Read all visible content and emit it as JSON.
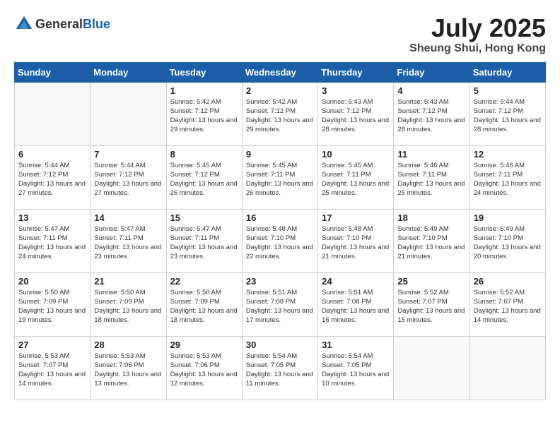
{
  "header": {
    "logo_general": "General",
    "logo_blue": "Blue",
    "month": "July 2025",
    "location": "Sheung Shui, Hong Kong"
  },
  "weekdays": [
    "Sunday",
    "Monday",
    "Tuesday",
    "Wednesday",
    "Thursday",
    "Friday",
    "Saturday"
  ],
  "weeks": [
    [
      {
        "day": "",
        "sunrise": "",
        "sunset": "",
        "daylight": ""
      },
      {
        "day": "",
        "sunrise": "",
        "sunset": "",
        "daylight": ""
      },
      {
        "day": "1",
        "sunrise": "Sunrise: 5:42 AM",
        "sunset": "Sunset: 7:12 PM",
        "daylight": "Daylight: 13 hours and 29 minutes."
      },
      {
        "day": "2",
        "sunrise": "Sunrise: 5:42 AM",
        "sunset": "Sunset: 7:12 PM",
        "daylight": "Daylight: 13 hours and 29 minutes."
      },
      {
        "day": "3",
        "sunrise": "Sunrise: 5:43 AM",
        "sunset": "Sunset: 7:12 PM",
        "daylight": "Daylight: 13 hours and 28 minutes."
      },
      {
        "day": "4",
        "sunrise": "Sunrise: 5:43 AM",
        "sunset": "Sunset: 7:12 PM",
        "daylight": "Daylight: 13 hours and 28 minutes."
      },
      {
        "day": "5",
        "sunrise": "Sunrise: 5:44 AM",
        "sunset": "Sunset: 7:12 PM",
        "daylight": "Daylight: 13 hours and 28 minutes."
      }
    ],
    [
      {
        "day": "6",
        "sunrise": "Sunrise: 5:44 AM",
        "sunset": "Sunset: 7:12 PM",
        "daylight": "Daylight: 13 hours and 27 minutes."
      },
      {
        "day": "7",
        "sunrise": "Sunrise: 5:44 AM",
        "sunset": "Sunset: 7:12 PM",
        "daylight": "Daylight: 13 hours and 27 minutes."
      },
      {
        "day": "8",
        "sunrise": "Sunrise: 5:45 AM",
        "sunset": "Sunset: 7:12 PM",
        "daylight": "Daylight: 13 hours and 26 minutes."
      },
      {
        "day": "9",
        "sunrise": "Sunrise: 5:45 AM",
        "sunset": "Sunset: 7:11 PM",
        "daylight": "Daylight: 13 hours and 26 minutes."
      },
      {
        "day": "10",
        "sunrise": "Sunrise: 5:45 AM",
        "sunset": "Sunset: 7:11 PM",
        "daylight": "Daylight: 13 hours and 25 minutes."
      },
      {
        "day": "11",
        "sunrise": "Sunrise: 5:46 AM",
        "sunset": "Sunset: 7:11 PM",
        "daylight": "Daylight: 13 hours and 25 minutes."
      },
      {
        "day": "12",
        "sunrise": "Sunrise: 5:46 AM",
        "sunset": "Sunset: 7:11 PM",
        "daylight": "Daylight: 13 hours and 24 minutes."
      }
    ],
    [
      {
        "day": "13",
        "sunrise": "Sunrise: 5:47 AM",
        "sunset": "Sunset: 7:11 PM",
        "daylight": "Daylight: 13 hours and 24 minutes."
      },
      {
        "day": "14",
        "sunrise": "Sunrise: 5:47 AM",
        "sunset": "Sunset: 7:11 PM",
        "daylight": "Daylight: 13 hours and 23 minutes."
      },
      {
        "day": "15",
        "sunrise": "Sunrise: 5:47 AM",
        "sunset": "Sunset: 7:11 PM",
        "daylight": "Daylight: 13 hours and 23 minutes."
      },
      {
        "day": "16",
        "sunrise": "Sunrise: 5:48 AM",
        "sunset": "Sunset: 7:10 PM",
        "daylight": "Daylight: 13 hours and 22 minutes."
      },
      {
        "day": "17",
        "sunrise": "Sunrise: 5:48 AM",
        "sunset": "Sunset: 7:10 PM",
        "daylight": "Daylight: 13 hours and 21 minutes."
      },
      {
        "day": "18",
        "sunrise": "Sunrise: 5:49 AM",
        "sunset": "Sunset: 7:10 PM",
        "daylight": "Daylight: 13 hours and 21 minutes."
      },
      {
        "day": "19",
        "sunrise": "Sunrise: 5:49 AM",
        "sunset": "Sunset: 7:10 PM",
        "daylight": "Daylight: 13 hours and 20 minutes."
      }
    ],
    [
      {
        "day": "20",
        "sunrise": "Sunrise: 5:50 AM",
        "sunset": "Sunset: 7:09 PM",
        "daylight": "Daylight: 13 hours and 19 minutes."
      },
      {
        "day": "21",
        "sunrise": "Sunrise: 5:50 AM",
        "sunset": "Sunset: 7:09 PM",
        "daylight": "Daylight: 13 hours and 18 minutes."
      },
      {
        "day": "22",
        "sunrise": "Sunrise: 5:50 AM",
        "sunset": "Sunset: 7:09 PM",
        "daylight": "Daylight: 13 hours and 18 minutes."
      },
      {
        "day": "23",
        "sunrise": "Sunrise: 5:51 AM",
        "sunset": "Sunset: 7:08 PM",
        "daylight": "Daylight: 13 hours and 17 minutes."
      },
      {
        "day": "24",
        "sunrise": "Sunrise: 5:51 AM",
        "sunset": "Sunset: 7:08 PM",
        "daylight": "Daylight: 13 hours and 16 minutes."
      },
      {
        "day": "25",
        "sunrise": "Sunrise: 5:52 AM",
        "sunset": "Sunset: 7:07 PM",
        "daylight": "Daylight: 13 hours and 15 minutes."
      },
      {
        "day": "26",
        "sunrise": "Sunrise: 5:52 AM",
        "sunset": "Sunset: 7:07 PM",
        "daylight": "Daylight: 13 hours and 14 minutes."
      }
    ],
    [
      {
        "day": "27",
        "sunrise": "Sunrise: 5:53 AM",
        "sunset": "Sunset: 7:07 PM",
        "daylight": "Daylight: 13 hours and 14 minutes."
      },
      {
        "day": "28",
        "sunrise": "Sunrise: 5:53 AM",
        "sunset": "Sunset: 7:06 PM",
        "daylight": "Daylight: 13 hours and 13 minutes."
      },
      {
        "day": "29",
        "sunrise": "Sunrise: 5:53 AM",
        "sunset": "Sunset: 7:06 PM",
        "daylight": "Daylight: 13 hours and 12 minutes."
      },
      {
        "day": "30",
        "sunrise": "Sunrise: 5:54 AM",
        "sunset": "Sunset: 7:05 PM",
        "daylight": "Daylight: 13 hours and 11 minutes."
      },
      {
        "day": "31",
        "sunrise": "Sunrise: 5:54 AM",
        "sunset": "Sunset: 7:05 PM",
        "daylight": "Daylight: 13 hours and 10 minutes."
      },
      {
        "day": "",
        "sunrise": "",
        "sunset": "",
        "daylight": ""
      },
      {
        "day": "",
        "sunrise": "",
        "sunset": "",
        "daylight": ""
      }
    ]
  ]
}
